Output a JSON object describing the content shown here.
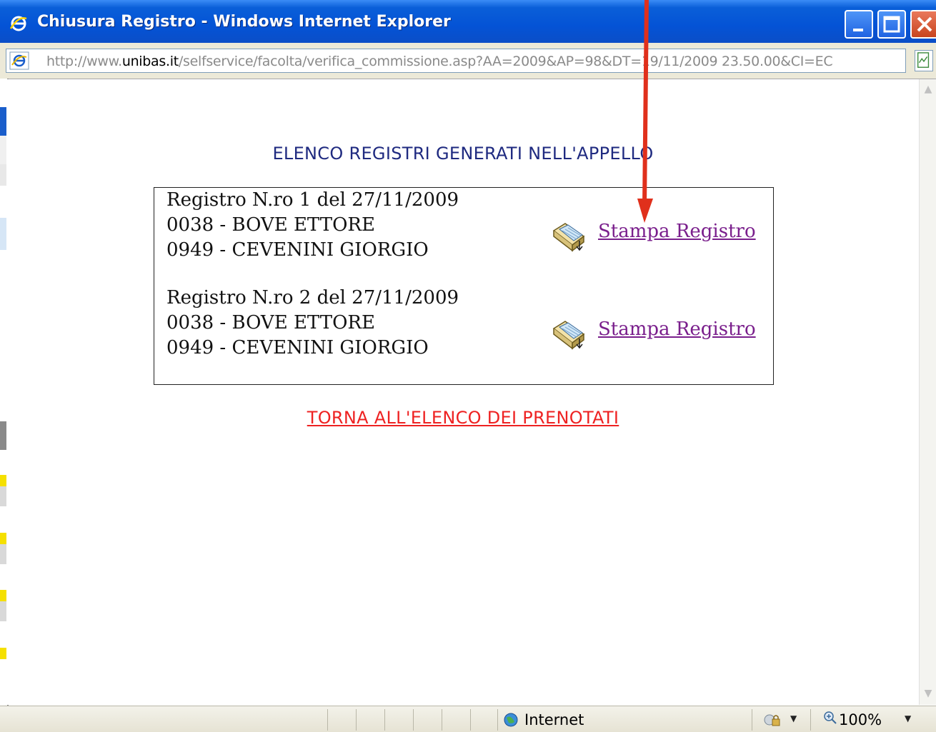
{
  "window": {
    "title": "Chiusura Registro - Windows Internet Explorer",
    "controls": [
      "minimize",
      "maximize",
      "close"
    ],
    "ie_icon": "ie-icon"
  },
  "address_bar": {
    "url_prefix": "http://www.",
    "url_domain": "unibas.it",
    "url_rest": "/selfservice/facolta/verifica_commissione.asp?AA=2009&AP=98&DT=19/11/2009 23.50.00&CI=EC"
  },
  "content": {
    "heading": "ELENCO REGISTRI GENERATI NELL'APPELLO",
    "registers": [
      {
        "title": "Registro N.ro 1 del 27/11/2009",
        "members": [
          "0038 - BOVE ETTORE",
          "0949 - CEVENINI GIORGIO"
        ],
        "print_label": "Stampa Registro"
      },
      {
        "title": "Registro N.ro 2 del 27/11/2009",
        "members": [
          "0038 - BOVE ETTORE",
          "0949 - CEVENINI GIORGIO"
        ],
        "print_label": "Stampa Registro"
      }
    ],
    "back_link": "TORNA ALL'ELENCO DEI PRENOTATI"
  },
  "status_bar": {
    "zone": "Internet",
    "zoom": "100%"
  },
  "colors": {
    "heading": "#1f2a80",
    "link_visited": "#7a1f8c",
    "back_link": "#ee2222",
    "annotation_arrow": "#e0301c",
    "titlebar": "#0453d6"
  }
}
